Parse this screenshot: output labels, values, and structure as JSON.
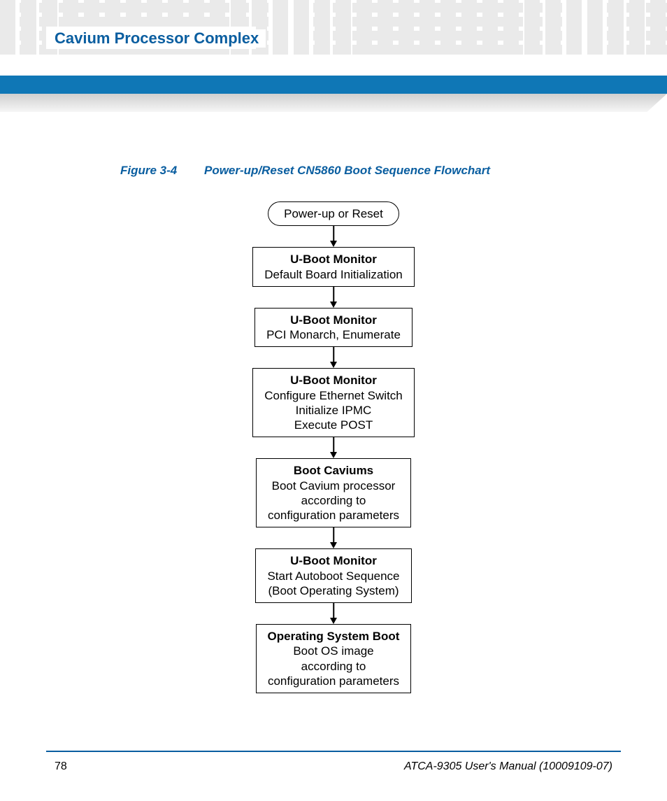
{
  "header": {
    "section_title": "Cavium Processor Complex"
  },
  "figure": {
    "number": "Figure 3-4",
    "title": "Power-up/Reset CN5860 Boot Sequence Flowchart"
  },
  "flowchart": {
    "start": {
      "text": "Power-up or Reset"
    },
    "steps": [
      {
        "title": "U-Boot Monitor",
        "body": "Default Board Initialization"
      },
      {
        "title": "U-Boot Monitor",
        "body": "PCI Monarch, Enumerate"
      },
      {
        "title": "U-Boot Monitor",
        "body": "Configure Ethernet Switch\nInitialize IPMC\nExecute POST"
      },
      {
        "title": "Boot Caviums",
        "body": "Boot Cavium processor\naccording to\nconfiguration parameters"
      },
      {
        "title": "U-Boot Monitor",
        "body": "Start Autoboot Sequence\n(Boot Operating System)"
      },
      {
        "title": "Operating System Boot",
        "body": "Boot OS image\naccording to\nconfiguration parameters"
      }
    ]
  },
  "footer": {
    "page_number": "78",
    "manual_title": "ATCA-9305 User's Manual",
    "doc_number": "(10009109-07)"
  }
}
